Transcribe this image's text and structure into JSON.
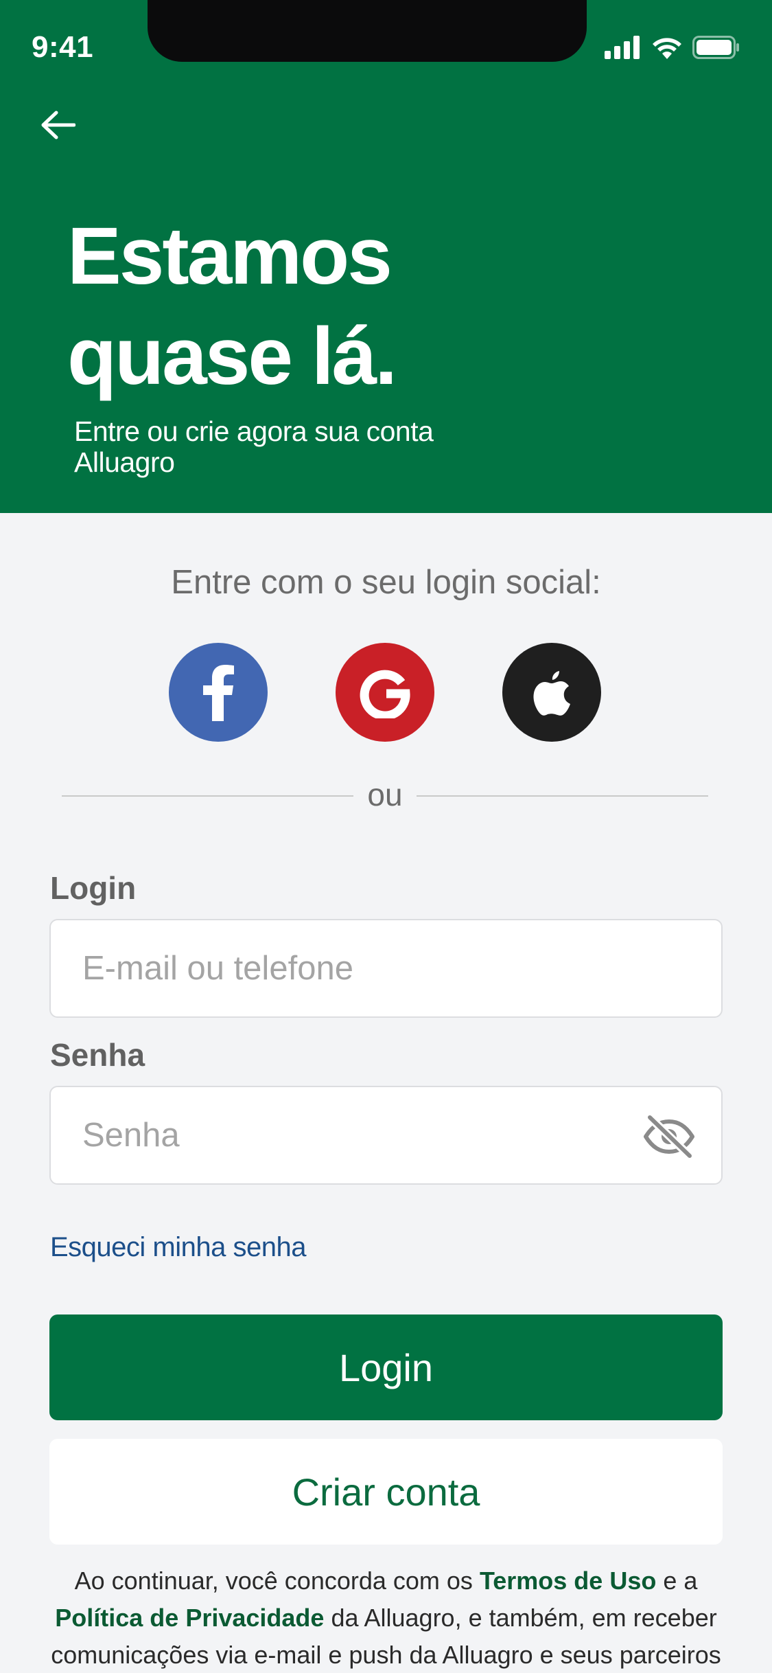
{
  "status_bar": {
    "time": "9:41"
  },
  "header": {
    "headline_line1": "Estamos",
    "headline_line2": "quase lá.",
    "subtitle_line1": "Entre ou crie agora sua conta",
    "subtitle_line2": "Alluagro"
  },
  "social": {
    "title": "Entre com o seu login social:",
    "providers": [
      "facebook-icon",
      "google-icon",
      "apple-icon"
    ],
    "colors": {
      "facebook": "#4267b2",
      "google": "#c92027",
      "apple": "#1f1f1f"
    }
  },
  "divider": {
    "text": "ou"
  },
  "form": {
    "login_label": "Login",
    "login_placeholder": "E-mail ou telefone",
    "password_label": "Senha",
    "password_placeholder": "Senha",
    "forgot_password": "Esqueci minha senha"
  },
  "buttons": {
    "login": "Login",
    "create_account": "Criar conta"
  },
  "terms": {
    "part1": "Ao continuar, você concorda com os ",
    "terms_link": "Termos de Uso",
    "part2": " e a",
    "privacy_link": "Política de Privacidade",
    "part3": " da Alluagro, e também, em receber",
    "part4": "comunicações via e-mail e push da Alluagro e seus parceiros"
  },
  "colors": {
    "brand_green": "#017242",
    "background": "#f3f4f6",
    "link_blue": "#1c4f8a"
  }
}
